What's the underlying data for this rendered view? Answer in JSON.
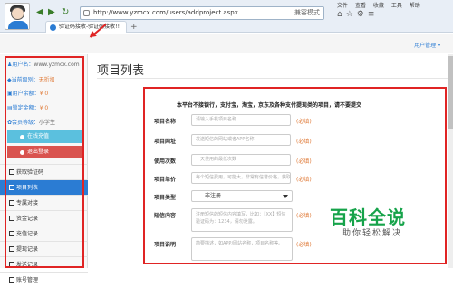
{
  "browser": {
    "url": "http://www.yzmcx.com/users/addproject.aspx",
    "mode_label": "兼容模式",
    "tab_title": "验证码接收-验证码接收!!",
    "new_tab": "+",
    "top_menu": [
      "文件",
      "查看",
      "收藏",
      "工具",
      "帮助"
    ],
    "back_icon": "◀",
    "forward_icon": "▶",
    "refresh_icon": "↻"
  },
  "header": {
    "user_menu": "用户管理 ▾"
  },
  "sidebar": {
    "username_label": "用户名：",
    "username": "www.yzmcx.com",
    "level_label": "当前级别：",
    "level": "无折扣",
    "balance_label": "用户余额：",
    "balance": "¥ 0",
    "frozen_label": "锁定金额：",
    "frozen": "¥ 0",
    "rank_label": "会员等级：",
    "rank": "小学生",
    "online_button": "在线充值",
    "logout_button": "退出登录",
    "nav": [
      {
        "label": "获取验证码",
        "active": false
      },
      {
        "label": "项目列表",
        "active": true
      },
      {
        "label": "专属对接",
        "active": false
      },
      {
        "label": "资金记录",
        "active": false
      },
      {
        "label": "充值记录",
        "active": false
      },
      {
        "label": "提现记录",
        "active": false
      },
      {
        "label": "发送记录",
        "active": false
      },
      {
        "label": "账号管理",
        "active": false
      }
    ]
  },
  "main": {
    "title": "项目列表",
    "notice": "本平台不接银行，支付宝，淘宝，京东及各种支付提现类的项目，请不要提交",
    "fields": {
      "name": {
        "label": "项目名称",
        "placeholder": "请输入手机项目名称",
        "required": "(必填)"
      },
      "url": {
        "label": "项目网址",
        "placeholder": "发送短信的网站或者APP名称",
        "required": "(必填)"
      },
      "count": {
        "label": "使用次数",
        "placeholder": "一天使用的最低次数",
        "required": "(必填)"
      },
      "price": {
        "label": "项目单价",
        "placeholder": "每个短信费用，可能大，非常有信誉价格，获取",
        "required": "(必填)"
      },
      "type": {
        "label": "项目类型",
        "value": "非注册",
        "required": "(必填)"
      },
      "sms": {
        "label": "短信内容",
        "placeholder": "注册短信的短信内容填写，比如：【XX】短信验证码为：1234，请勿泄露。",
        "required": "(必填)"
      },
      "desc": {
        "label": "项目说明",
        "placeholder": "简要描述，如APP/网站名称，项目名称等。",
        "required": "(必填)"
      }
    }
  },
  "watermark": {
    "main": "百科全说",
    "sub": "助你轻松解决"
  },
  "colors": {
    "accent": "#2b7cd3",
    "required": "#e07b39",
    "highlight": "#e02424",
    "online_button": "#5bc0de",
    "logout_button": "#d9534f"
  }
}
